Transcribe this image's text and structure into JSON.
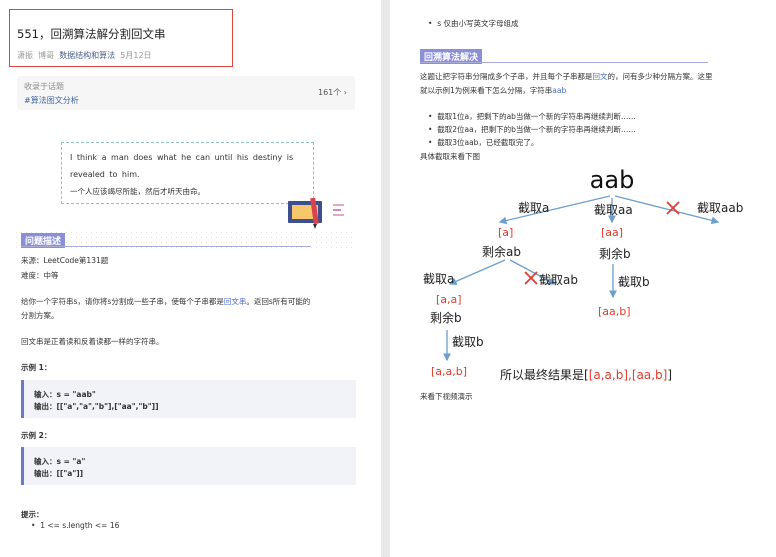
{
  "left": {
    "title": "551，回溯算法解分割回文串",
    "author": "潇振",
    "author2": "博哥",
    "tag": "数据结构和算法",
    "date": "5月12日",
    "topic_label": "收录于话题",
    "topic_hash": "#算法图文分析",
    "topic_count": "161个 ›",
    "quote_en": "I think a man does what he can until his destiny is revealed to him.",
    "quote_zh": "一个人应该竭尽所能，然后才听天由命。",
    "sec1": "问题描述",
    "source": "来源：LeetCode第131题",
    "difficulty": "难度：中等",
    "desc1a": "给你一个字符串s，请你将s分割成一些子串，使每个子串都是",
    "desc1b": "回文串",
    "desc1c": "。返回s所有可能的",
    "desc2": "分割方案。",
    "desc3": "回文串是正着读和反着读都一样的字符串。",
    "ex1": "示例 1：",
    "ex1_in": "输入：s = \"aab\"",
    "ex1_out": "输出：[[\"a\",\"a\",\"b\"],[\"aa\",\"b\"]]",
    "ex2": "示例 2：",
    "ex2_in": "输入：s = \"a\"",
    "ex2_out": "输出：[[\"a\"]]",
    "hint": "提示：",
    "hint1": "1 <= s.length <= 16"
  },
  "right": {
    "hint2": "s 仅由小写英文字母组成",
    "sec2": "回溯算法解决",
    "p1a": "这题让把字符串分隔成多个子串，并且每个子串都是",
    "p1b": "回文",
    "p1c": "的，问有多少种分隔方案。这里",
    "p2a": "就以示例1为例来看下怎么分隔，字符串",
    "p2b": "aab",
    "b1": "截取1位a，把剩下的ab当做一个新的字符串再继续判断……",
    "b2": "截取2位aa，把剩下的b当做一个新的字符串再继续判断……",
    "b3": "截取3位aab，已经截取完了。",
    "p3": "具体截取来看下图",
    "t_root": "aab",
    "t_l1": "截取a",
    "t_l2": "截取aa",
    "t_l3": "截取aab",
    "t_r1": "[a]",
    "t_r2": "[aa]",
    "t_rem1": "剩余ab",
    "t_rem2": "剩余b",
    "t_cut_a": "截取a",
    "t_cut_ab": "截取ab",
    "t_cut_b": "截取b",
    "t_aa": "[a,a]",
    "t_aab_res": "[aa,b]",
    "t_rem3": "剩余b",
    "t_cut_b2": "截取b",
    "t_final1": "[a,a,b]",
    "t_result_a": "所以最终结果是[",
    "t_result_b": "[a,a,b],[aa,b]",
    "t_result_c": "]",
    "video": "来看下视频演示"
  },
  "colors": {
    "accent": "#8b8fd8",
    "red": "#e33b2e",
    "arrow": "#6a9fd0",
    "link": "#4a6ec9"
  }
}
